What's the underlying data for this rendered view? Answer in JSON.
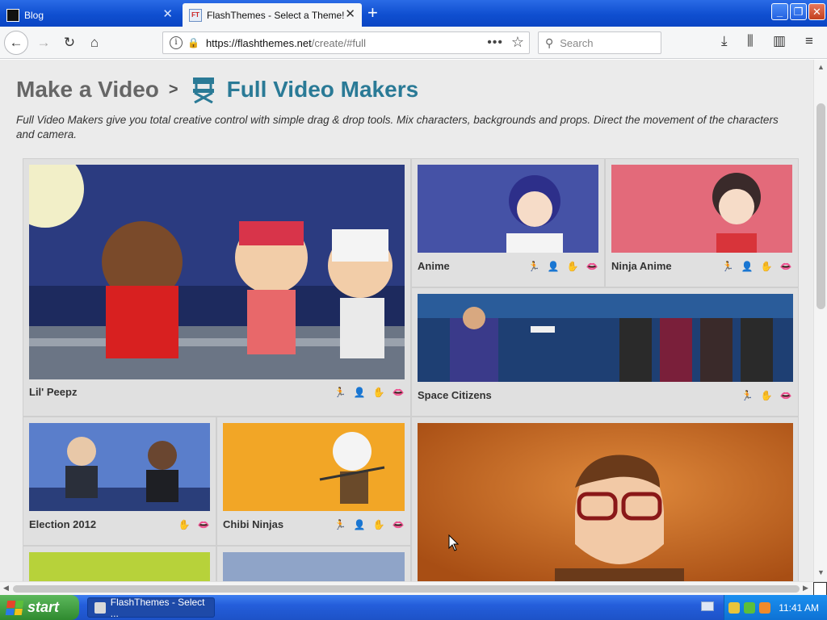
{
  "browser": {
    "tabs": [
      {
        "title": "Blog"
      },
      {
        "title": "FlashThemes - Select a Theme!",
        "favicon_text": "FT"
      }
    ],
    "url": "https://flashthemes.net/create/#full",
    "url_host": "https://flashthemes.net",
    "url_rest": "/create/#full",
    "search_placeholder": "Search"
  },
  "page": {
    "breadcrumb_root": "Make a Video",
    "breadcrumb_sep": ">",
    "title": "Full Video Makers",
    "intro": "Full Video Makers give you total creative control with simple drag & drop tools. Mix characters, backgrounds and props. Direct the movement of the characters and camera."
  },
  "themes": [
    {
      "name": "Lil' Peepz",
      "features": [
        "run-icon",
        "person-icon",
        "hand-icon",
        "lips-icon"
      ]
    },
    {
      "name": "Anime",
      "features": [
        "run-icon",
        "person-icon",
        "hand-icon",
        "lips-icon"
      ]
    },
    {
      "name": "Ninja Anime",
      "features": [
        "run-icon",
        "person-icon",
        "hand-icon",
        "lips-icon"
      ]
    },
    {
      "name": "Space Citizens",
      "features": [
        "run-icon",
        "hand-icon",
        "lips-icon"
      ]
    },
    {
      "name": "Election 2012",
      "features": [
        "hand-icon",
        "lips-icon"
      ]
    },
    {
      "name": "Chibi Ninjas",
      "features": [
        "run-icon",
        "person-icon",
        "hand-icon",
        "lips-icon"
      ]
    }
  ],
  "taskbar": {
    "start_label": "start",
    "window_title": "FlashThemes - Select ...",
    "clock": "11:41 AM"
  },
  "colors": {
    "accent_title": "#2a7a96",
    "taskbar_blue": "#245edb",
    "start_green": "#3a9a3a"
  }
}
